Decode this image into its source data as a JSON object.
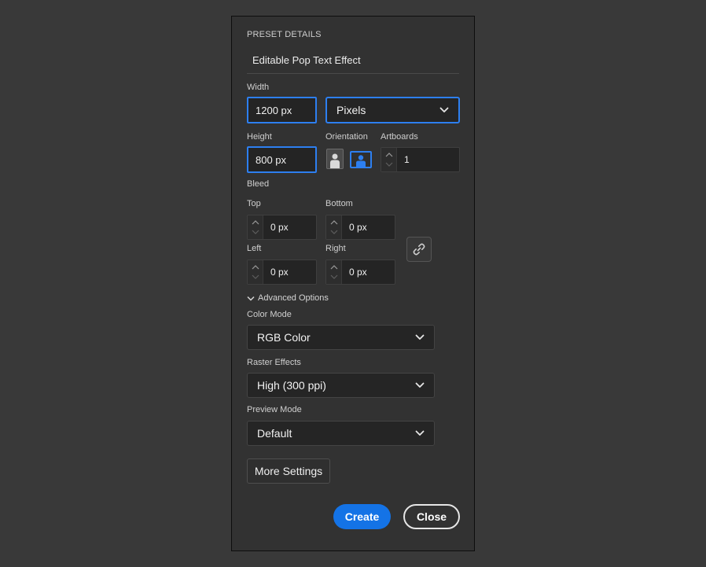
{
  "preset": {
    "title": "PRESET DETAILS",
    "document_name": "Editable Pop Text Effect"
  },
  "width": {
    "label": "Width",
    "value": "1200 px"
  },
  "units": {
    "value": "Pixels"
  },
  "height": {
    "label": "Height",
    "value": "800 px"
  },
  "orientation": {
    "label": "Orientation",
    "selected": "landscape"
  },
  "artboards": {
    "label": "Artboards",
    "value": "1"
  },
  "bleed": {
    "label": "Bleed",
    "top": {
      "label": "Top",
      "value": "0 px"
    },
    "bottom": {
      "label": "Bottom",
      "value": "0 px"
    },
    "left": {
      "label": "Left",
      "value": "0 px"
    },
    "right": {
      "label": "Right",
      "value": "0 px"
    }
  },
  "advanced": {
    "label": "Advanced Options",
    "color_mode": {
      "label": "Color Mode",
      "value": "RGB Color"
    },
    "raster_effects": {
      "label": "Raster Effects",
      "value": "High (300 ppi)"
    },
    "preview_mode": {
      "label": "Preview Mode",
      "value": "Default"
    }
  },
  "buttons": {
    "more_settings": "More Settings",
    "create": "Create",
    "close": "Close"
  },
  "colors": {
    "accent": "#2d7ff0",
    "primary_button": "#1473e6",
    "panel": "#323232",
    "background": "#393939"
  },
  "icons": {
    "chevron": "chevron-down-icon",
    "link": "link-icon",
    "portrait": "portrait-icon",
    "landscape": "landscape-icon"
  }
}
